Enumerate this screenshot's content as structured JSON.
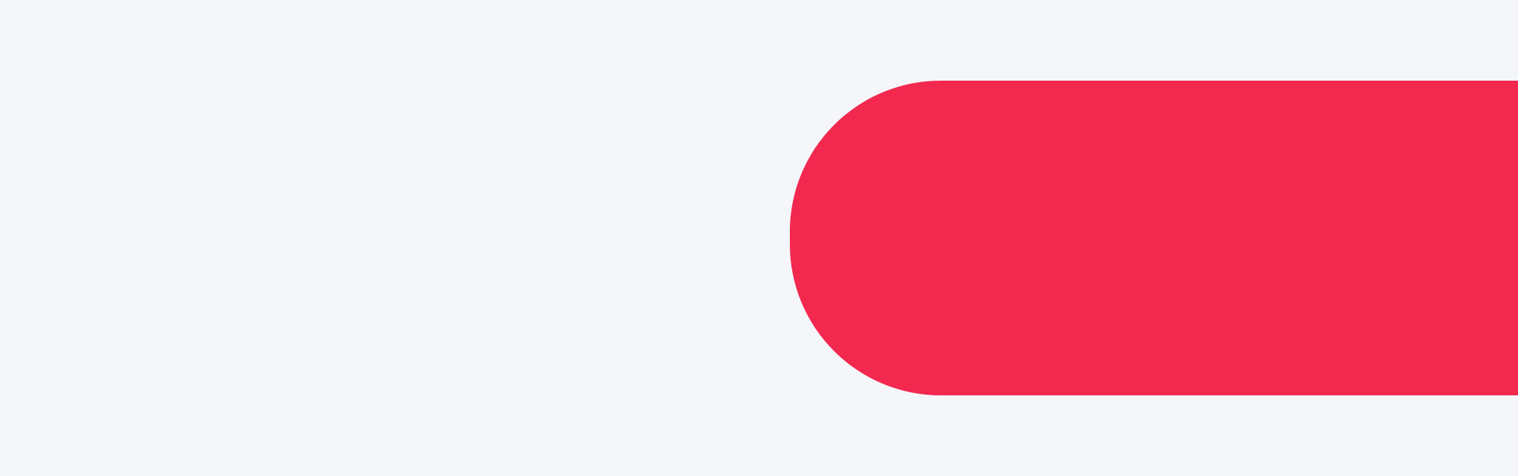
{
  "colors": {
    "background": "#f5f6fa",
    "accent": "#f2284f"
  },
  "banner": {
    "shape": "rounded-left-red-bar"
  }
}
